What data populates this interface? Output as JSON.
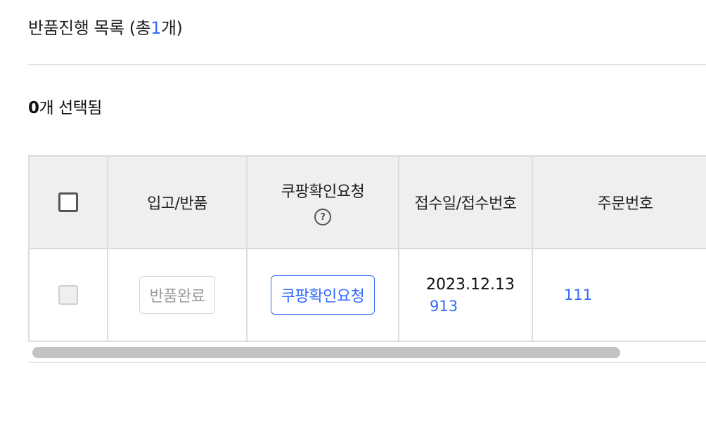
{
  "header": {
    "title_prefix": "반품진행 목록 (총",
    "title_count": "1",
    "title_suffix": "개)"
  },
  "selection": {
    "count": "0",
    "suffix": "개 선택됨"
  },
  "table": {
    "columns": {
      "inbound_return": "입고/반품",
      "coupang_check": "쿠팡확인요청",
      "receipt": "접수일/접수번호",
      "order_number": "주문번호"
    },
    "help_icon_glyph": "?",
    "rows": [
      {
        "status_label": "반품완료",
        "action_label": "쿠팡확인요청",
        "receipt_date": "2023.12.13",
        "receipt_number": "913",
        "order_number": "111"
      }
    ]
  },
  "colors": {
    "accent": "#346aff",
    "header_bg": "#efefef",
    "border": "#dcdcdc"
  },
  "icons": {
    "help": "question-circle-icon"
  }
}
